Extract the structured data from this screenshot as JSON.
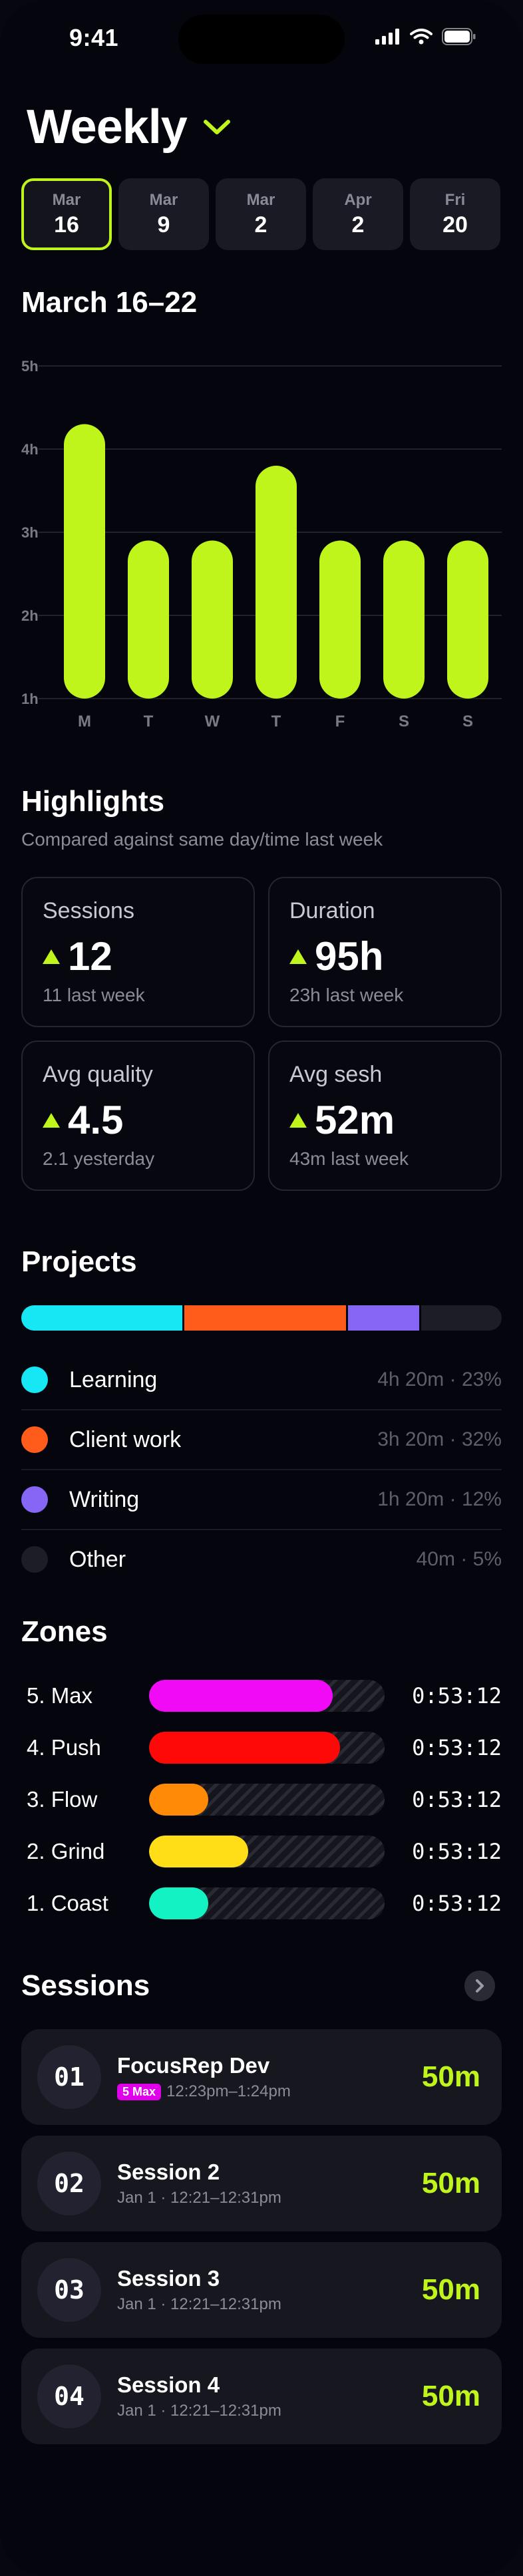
{
  "status_bar": {
    "time": "9:41"
  },
  "header": {
    "title": "Weekly"
  },
  "date_tabs": [
    {
      "month": "Mar",
      "day": "16",
      "selected": true
    },
    {
      "month": "Mar",
      "day": "9",
      "selected": false
    },
    {
      "month": "Mar",
      "day": "2",
      "selected": false
    },
    {
      "month": "Apr",
      "day": "2",
      "selected": false
    },
    {
      "month": "Fri",
      "day": "20",
      "selected": false
    }
  ],
  "week": {
    "range_label": "March 16–22"
  },
  "chart_data": {
    "type": "bar",
    "categories": [
      "M",
      "T",
      "W",
      "T",
      "F",
      "S",
      "S"
    ],
    "values": [
      4.3,
      2.9,
      2.9,
      3.8,
      2.9,
      2.9,
      2.9
    ],
    "y_ticks": [
      "5h",
      "4h",
      "3h",
      "2h",
      "1h"
    ],
    "ylim": [
      1,
      5
    ],
    "grid": true,
    "bar_color": "#c0f51c"
  },
  "highlights": {
    "title": "Highlights",
    "subtitle": "Compared against same day/time last week",
    "cards": [
      {
        "label": "Sessions",
        "value": "12",
        "comparison": "11 last week",
        "trend": "up"
      },
      {
        "label": "Duration",
        "value": "95h",
        "comparison": "23h last week",
        "trend": "up"
      },
      {
        "label": "Avg quality",
        "value": "4.5",
        "comparison": "2.1 yesterday",
        "trend": "up"
      },
      {
        "label": "Avg sesh",
        "value": "52m",
        "comparison": "43m last week",
        "trend": "up"
      }
    ]
  },
  "projects": {
    "title": "Projects",
    "items": [
      {
        "name": "Learning",
        "stat": "4h 20m · 23%",
        "color": "#17e6f5",
        "share": 0.34
      },
      {
        "name": "Client work",
        "stat": "3h 20m · 32%",
        "color": "#ff5c1c",
        "share": 0.34
      },
      {
        "name": "Writing",
        "stat": "1h 20m · 12%",
        "color": "#8566f5",
        "share": 0.15
      },
      {
        "name": "Other",
        "stat": "40m · 5%",
        "color": "#1d1d28",
        "share": 0.17
      }
    ]
  },
  "zones": {
    "title": "Zones",
    "items": [
      {
        "name": "5. Max",
        "time": "0:53:12",
        "color": "#f00af5",
        "fill": 0.78
      },
      {
        "name": "4. Push",
        "time": "0:53:12",
        "color": "#ff0808",
        "fill": 0.81
      },
      {
        "name": "3. Flow",
        "time": "0:53:12",
        "color": "#ff8a05",
        "fill": 0.25
      },
      {
        "name": "2. Grind",
        "time": "0:53:12",
        "color": "#ffdd17",
        "fill": 0.42
      },
      {
        "name": "1. Coast",
        "time": "0:53:12",
        "color": "#12f2c2",
        "fill": 0.25
      }
    ]
  },
  "sessions": {
    "title": "Sessions",
    "items": [
      {
        "number": "01",
        "name": "FocusRep Dev",
        "badge": "5 Max",
        "meta": "12:23pm–1:24pm",
        "duration": "50m"
      },
      {
        "number": "02",
        "name": "Session 2",
        "badge": "",
        "meta": "Jan 1 · 12:21–12:31pm",
        "duration": "50m"
      },
      {
        "number": "03",
        "name": "Session 3",
        "badge": "",
        "meta": "Jan 1 · 12:21–12:31pm",
        "duration": "50m"
      },
      {
        "number": "04",
        "name": "Session 4",
        "badge": "",
        "meta": "Jan 1 · 12:21–12:31pm",
        "duration": "50m"
      }
    ]
  },
  "icons": {
    "dropdown": "chevron-down-icon",
    "trend": "triangle-up-icon",
    "more": "chevron-right-icon",
    "signal": "cellular-signal-icon",
    "wifi": "wifi-icon",
    "battery": "battery-icon"
  }
}
